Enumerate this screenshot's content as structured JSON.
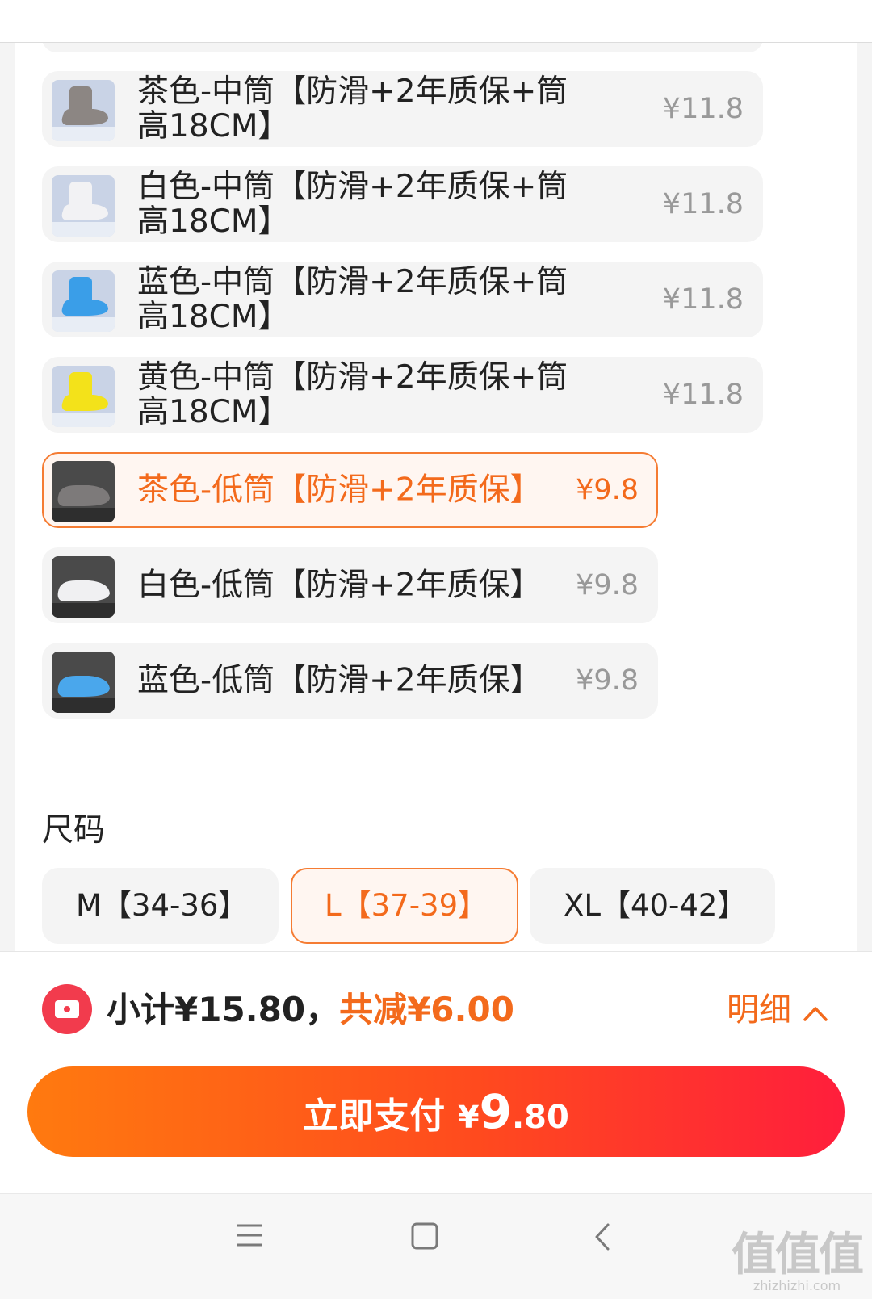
{
  "skus": [
    {
      "label": "茶色-中筒【防滑+2年质保+筒高18CM】",
      "price": "¥11.8",
      "selected": false,
      "swatch": "#8c8683"
    },
    {
      "label": "白色-中筒【防滑+2年质保+筒高18CM】",
      "price": "¥11.8",
      "selected": false,
      "swatch": "#f2f2f4"
    },
    {
      "label": "蓝色-中筒【防滑+2年质保+筒高18CM】",
      "price": "¥11.8",
      "selected": false,
      "swatch": "#3a9ee8"
    },
    {
      "label": "黄色-中筒【防滑+2年质保+筒高18CM】",
      "price": "¥11.8",
      "selected": false,
      "swatch": "#f3e21a"
    },
    {
      "label": "茶色-低筒【防滑+2年质保】",
      "price": "¥9.8",
      "selected": true,
      "swatch": "#7d7a7a"
    },
    {
      "label": "白色-低筒【防滑+2年质保】",
      "price": "¥9.8",
      "selected": false,
      "swatch": "#f0f0f2"
    },
    {
      "label": "蓝色-低筒【防滑+2年质保】",
      "price": "¥9.8",
      "selected": false,
      "swatch": "#4aa7ec"
    }
  ],
  "size": {
    "title": "尺码",
    "options": [
      {
        "label": "M【34-36】",
        "selected": false
      },
      {
        "label": "L【37-39】",
        "selected": true
      },
      {
        "label": "XL【40-42】",
        "selected": false
      }
    ]
  },
  "footer": {
    "subtotal": "小计¥15.80，",
    "discount": "共减¥6.00",
    "detail_label": "明细",
    "pay_label": "立即支付",
    "pay_currency": "¥",
    "pay_int": "9",
    "pay_dec": ".80"
  },
  "colors": {
    "accent": "#f36a1c",
    "pay_start": "#ff7a0f",
    "pay_end": "#ff1e3c",
    "coupon": "#f23b4d"
  },
  "icons": {
    "coupon": "coupon-icon",
    "detail": "chevron-up-icon",
    "nav_menu": "menu-icon",
    "nav_home": "home-icon",
    "nav_back": "back-icon"
  },
  "watermark": {
    "main": "值值值",
    "sub": "zhizhizhi.com"
  }
}
